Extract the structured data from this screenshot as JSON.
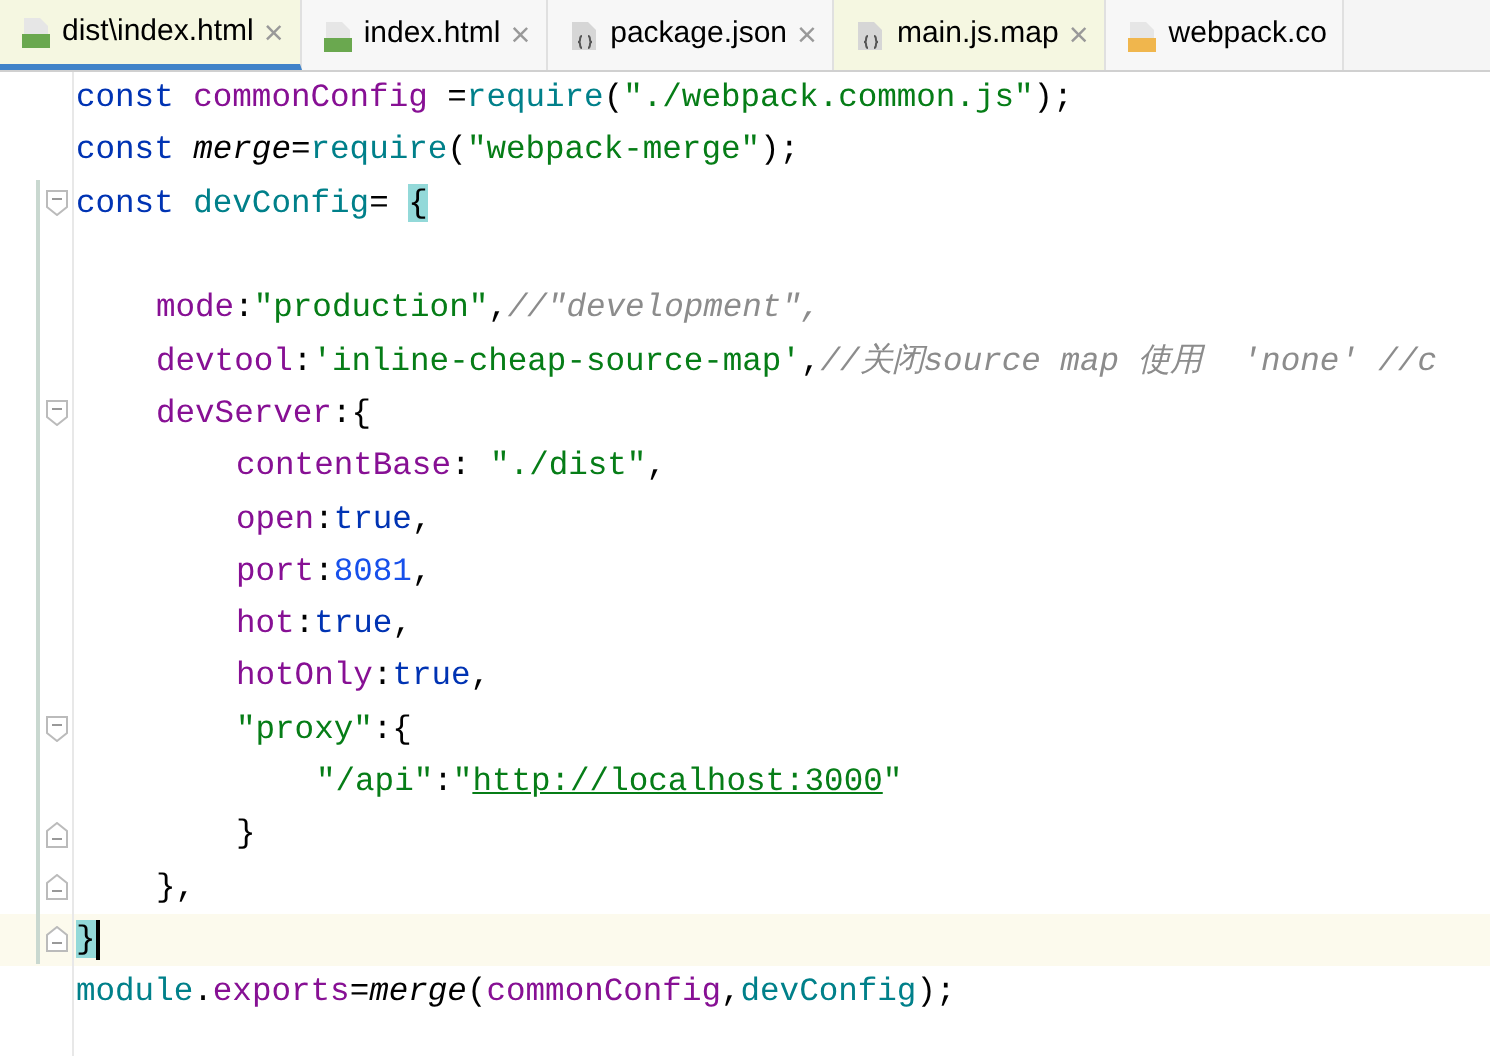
{
  "tabs": [
    {
      "label": "dist\\index.html",
      "kind": "html",
      "tinted": true,
      "selected": true,
      "close": "×"
    },
    {
      "label": "index.html",
      "kind": "html",
      "tinted": false,
      "selected": false,
      "close": "×"
    },
    {
      "label": "package.json",
      "kind": "json",
      "tinted": false,
      "selected": false,
      "close": "×"
    },
    {
      "label": "main.js.map",
      "kind": "json",
      "tinted": true,
      "selected": false,
      "close": "×"
    },
    {
      "label": "webpack.co",
      "kind": "js",
      "tinted": false,
      "selected": false
    }
  ],
  "lines": [
    {
      "fold_open": false,
      "fold_close": false,
      "current": false,
      "tokens": [
        {
          "t": "const ",
          "kind": "keyword"
        },
        {
          "t": "commonConfig",
          "kind": "variable"
        },
        {
          "t": " =",
          "kind": "plain"
        },
        {
          "t": "require",
          "kind": "call"
        },
        {
          "t": "(",
          "kind": "plain"
        },
        {
          "t": "\"./webpack.common.js\"",
          "kind": "string"
        },
        {
          "t": ");",
          "kind": "plain"
        }
      ]
    },
    {
      "fold_open": false,
      "fold_close": false,
      "current": false,
      "tokens": [
        {
          "t": "const ",
          "kind": "keyword"
        },
        {
          "t": "merge",
          "kind": "italic"
        },
        {
          "t": "=",
          "kind": "plain"
        },
        {
          "t": "require",
          "kind": "call"
        },
        {
          "t": "(",
          "kind": "plain"
        },
        {
          "t": "\"webpack-merge\"",
          "kind": "string"
        },
        {
          "t": ");",
          "kind": "plain"
        }
      ]
    },
    {
      "fold_open": true,
      "fold_close": false,
      "current": false,
      "tokens": [
        {
          "t": "const ",
          "kind": "keyword"
        },
        {
          "t": "devConfig",
          "kind": "call"
        },
        {
          "t": "= ",
          "kind": "plain"
        },
        {
          "t": "{",
          "kind": "matched"
        }
      ]
    },
    {
      "fold_open": false,
      "fold_close": false,
      "current": false
    },
    {
      "fold_open": false,
      "fold_close": false,
      "current": false,
      "tokens": [
        {
          "t": "mode",
          "kind": "variable"
        },
        {
          "t": ":",
          "kind": "plain"
        },
        {
          "t": "\"production\"",
          "kind": "string"
        },
        {
          "t": ",",
          "kind": "plain"
        },
        {
          "t": "//\"development\",",
          "kind": "comment"
        }
      ]
    },
    {
      "fold_open": false,
      "fold_close": false,
      "current": false,
      "tokens": [
        {
          "t": "devtool",
          "kind": "variable"
        },
        {
          "t": ":",
          "kind": "plain"
        },
        {
          "t": "'inline-cheap-source-map'",
          "kind": "string"
        },
        {
          "t": ",",
          "kind": "plain"
        },
        {
          "t": "//关闭source map 使用  'none' //c",
          "kind": "comment"
        }
      ]
    },
    {
      "fold_open": true,
      "fold_close": false,
      "current": false,
      "tokens": [
        {
          "t": "devServer",
          "kind": "variable"
        },
        {
          "t": ":{",
          "kind": "plain"
        }
      ]
    },
    {
      "fold_open": false,
      "fold_close": false,
      "current": false,
      "tokens": [
        {
          "t": "contentBase",
          "kind": "variable"
        },
        {
          "t": ": ",
          "kind": "plain"
        },
        {
          "t": "\"./dist\"",
          "kind": "string"
        },
        {
          "t": ",",
          "kind": "plain"
        }
      ]
    },
    {
      "fold_open": false,
      "fold_close": false,
      "current": false,
      "tokens": [
        {
          "t": "open",
          "kind": "variable"
        },
        {
          "t": ":",
          "kind": "plain"
        },
        {
          "t": "true",
          "kind": "keyword"
        },
        {
          "t": ",",
          "kind": "plain"
        }
      ]
    },
    {
      "fold_open": false,
      "fold_close": false,
      "current": false,
      "tokens": [
        {
          "t": "port",
          "kind": "variable"
        },
        {
          "t": ":",
          "kind": "plain"
        },
        {
          "t": "8081",
          "kind": "number"
        },
        {
          "t": ",",
          "kind": "plain"
        }
      ]
    },
    {
      "fold_open": false,
      "fold_close": false,
      "current": false,
      "tokens": [
        {
          "t": "hot",
          "kind": "variable"
        },
        {
          "t": ":",
          "kind": "plain"
        },
        {
          "t": "true",
          "kind": "keyword"
        },
        {
          "t": ",",
          "kind": "plain"
        }
      ]
    },
    {
      "fold_open": false,
      "fold_close": false,
      "current": false,
      "tokens": [
        {
          "t": "hotOnly",
          "kind": "variable"
        },
        {
          "t": ":",
          "kind": "plain"
        },
        {
          "t": "true",
          "kind": "keyword"
        },
        {
          "t": ",",
          "kind": "plain"
        }
      ]
    },
    {
      "fold_open": true,
      "fold_close": false,
      "current": false,
      "tokens": [
        {
          "t": "\"proxy\"",
          "kind": "string"
        },
        {
          "t": ":{",
          "kind": "plain"
        }
      ]
    },
    {
      "fold_open": false,
      "fold_close": false,
      "current": false,
      "tokens": [
        {
          "t": "\"/api\"",
          "kind": "string"
        },
        {
          "t": ":",
          "kind": "plain"
        },
        {
          "t": "\"",
          "kind": "string"
        },
        {
          "t": "http://localhost:3000",
          "kind": "link"
        },
        {
          "t": "\"",
          "kind": "string"
        }
      ]
    },
    {
      "fold_open": false,
      "fold_close": true,
      "current": false,
      "tokens": [
        {
          "t": "}",
          "kind": "plain"
        }
      ]
    },
    {
      "fold_open": false,
      "fold_close": true,
      "current": false,
      "tokens": [
        {
          "t": "},",
          "kind": "plain"
        }
      ]
    },
    {
      "fold_open": false,
      "fold_close": true,
      "current": true,
      "tokens": [
        {
          "t": "}",
          "kind": "matched"
        }
      ]
    },
    {
      "fold_open": false,
      "fold_close": false,
      "current": false,
      "tokens": [
        {
          "t": "module",
          "kind": "call"
        },
        {
          "t": ".",
          "kind": "plain"
        },
        {
          "t": "exports",
          "kind": "variable"
        },
        {
          "t": "=",
          "kind": "plain"
        },
        {
          "t": "merge",
          "kind": "italic"
        },
        {
          "t": "(",
          "kind": "plain"
        },
        {
          "t": "commonConfig",
          "kind": "variable"
        },
        {
          "t": ",",
          "kind": "plain"
        },
        {
          "t": "devConfig",
          "kind": "call"
        },
        {
          "t": ");",
          "kind": "plain"
        }
      ]
    }
  ]
}
